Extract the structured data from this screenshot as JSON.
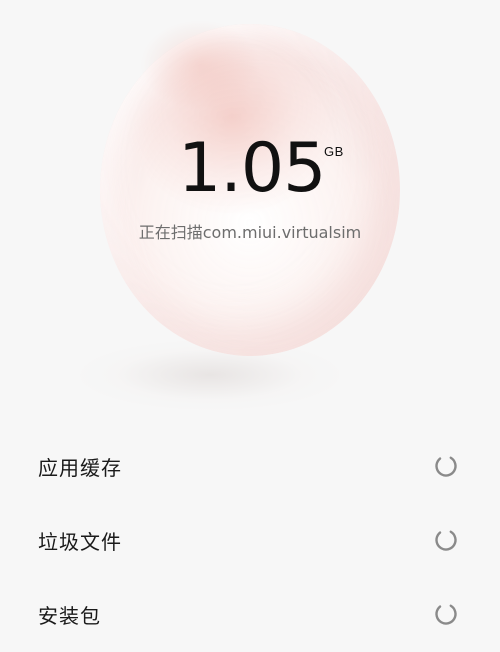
{
  "scan": {
    "size_value": "1.05",
    "size_unit": "GB",
    "status_text": "正在扫描com.miui.virtualsim"
  },
  "items": [
    {
      "label": "应用缓存",
      "icon": "loading-spinner-icon"
    },
    {
      "label": "垃圾文件",
      "icon": "loading-spinner-icon"
    },
    {
      "label": "安装包",
      "icon": "loading-spinner-icon"
    }
  ],
  "colors": {
    "background": "#f7f7f7",
    "orb_tint": "#eeb4ac",
    "text_primary": "#111111",
    "text_secondary": "#6d6d6d",
    "spinner": "#8a8a8a"
  }
}
